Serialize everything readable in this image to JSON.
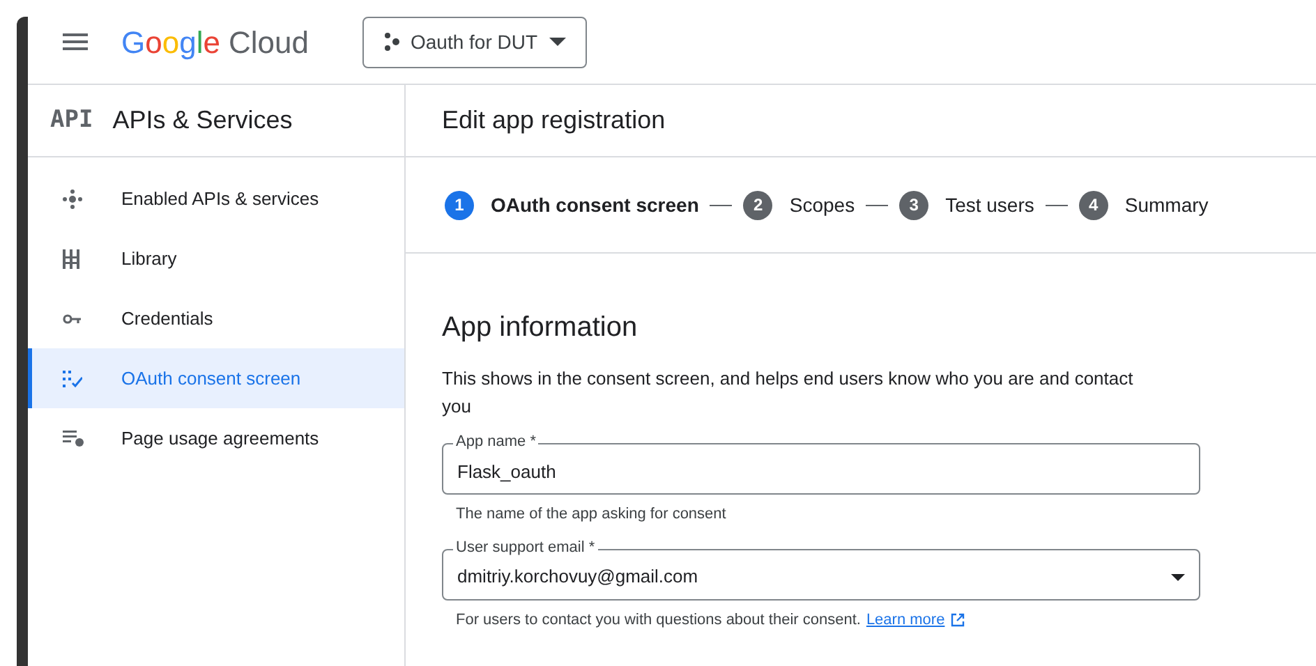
{
  "header": {
    "logo_word": "Google",
    "logo_product": "Cloud",
    "project": "Oauth for DUT"
  },
  "sidebar": {
    "badge": "API",
    "title": "APIs & Services",
    "items": [
      {
        "label": "Enabled APIs & services",
        "selected": false
      },
      {
        "label": "Library",
        "selected": false
      },
      {
        "label": "Credentials",
        "selected": false
      },
      {
        "label": "OAuth consent screen",
        "selected": true
      },
      {
        "label": "Page usage agreements",
        "selected": false
      }
    ]
  },
  "page": {
    "title": "Edit app registration",
    "steps": [
      {
        "number": "1",
        "label": "OAuth consent screen",
        "selected": true
      },
      {
        "number": "2",
        "label": "Scopes",
        "selected": false
      },
      {
        "number": "3",
        "label": "Test users",
        "selected": false
      },
      {
        "number": "4",
        "label": "Summary",
        "selected": false
      }
    ],
    "section_title": "App information",
    "section_text": "This shows in the consent screen, and helps end users know who you are and contact you",
    "fields": [
      {
        "kind": "text",
        "label": "App name *",
        "value": "Flask_oauth",
        "help": "The name of the app asking for consent"
      },
      {
        "kind": "select",
        "label": "User support email *",
        "value": "dmitriy.korchovuy@gmail.com",
        "help": "For users to contact you with questions about their consent.",
        "link": "Learn more"
      }
    ]
  }
}
